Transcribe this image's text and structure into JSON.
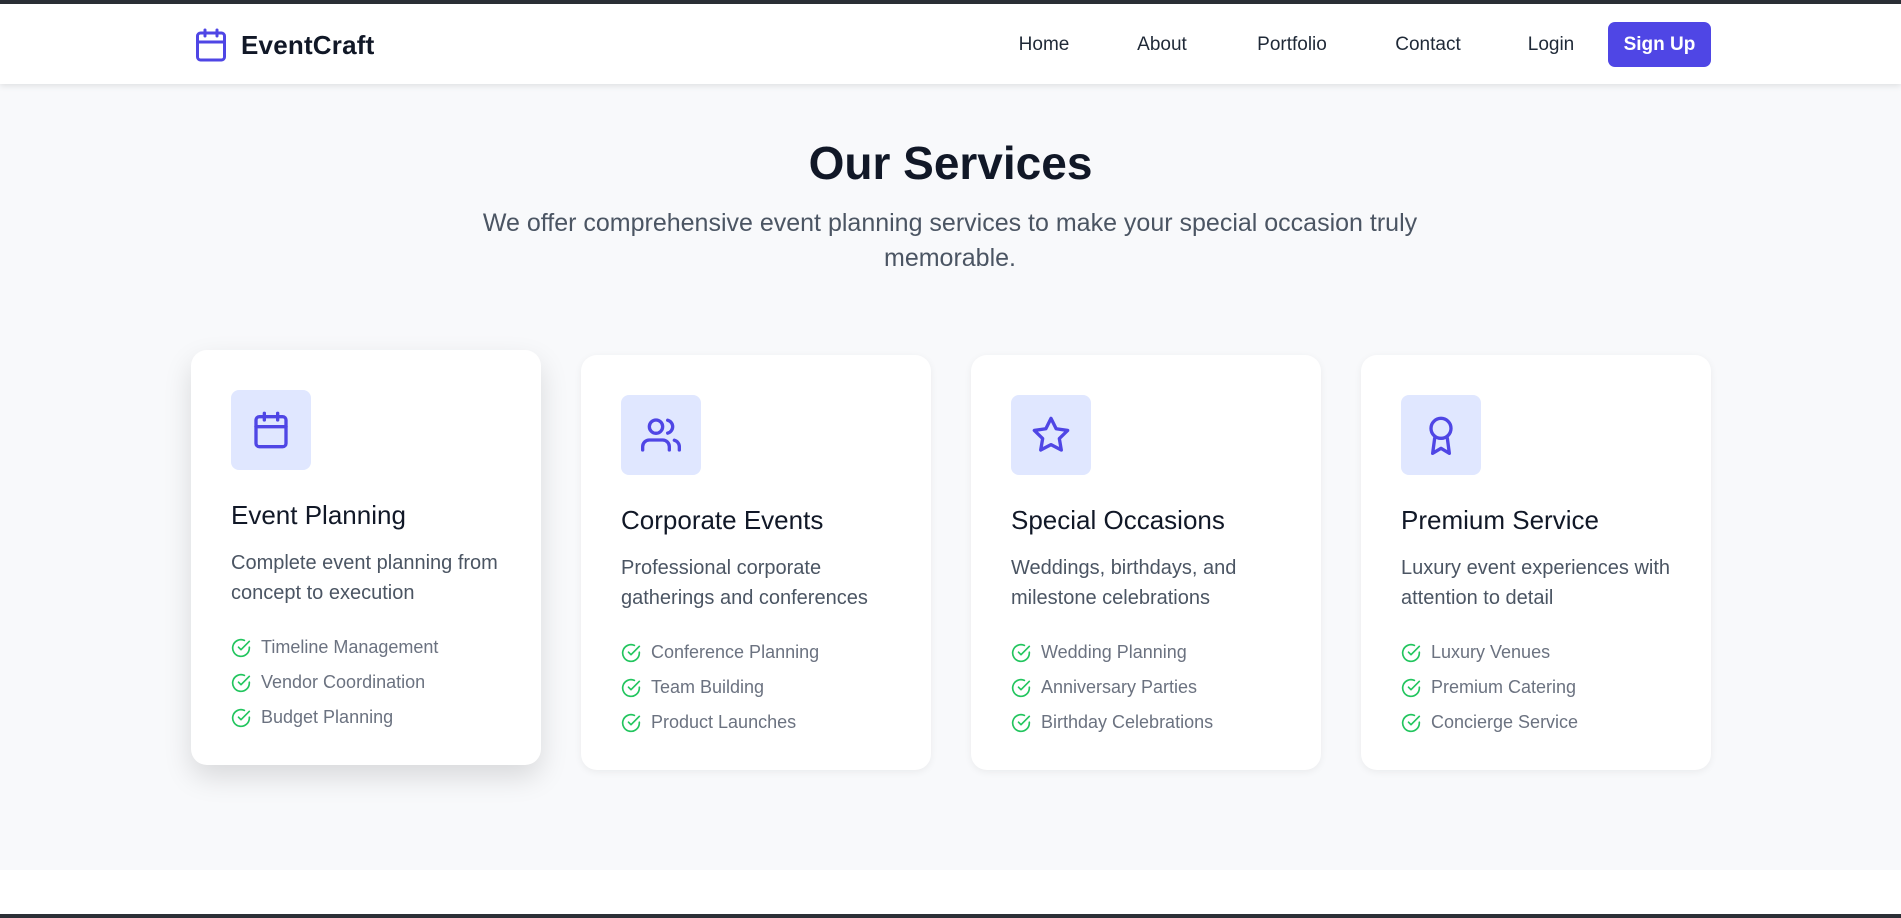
{
  "brand": {
    "name": "EventCraft",
    "icon": "calendar-icon"
  },
  "nav": {
    "links": [
      {
        "label": "Home",
        "name": "nav-link-home"
      },
      {
        "label": "About",
        "name": "nav-link-about"
      },
      {
        "label": "Portfolio",
        "name": "nav-link-portfolio"
      },
      {
        "label": "Contact",
        "name": "nav-link-contact"
      },
      {
        "label": "Login",
        "name": "nav-link-login"
      }
    ],
    "signup_label": "Sign Up"
  },
  "services": {
    "title": "Our Services",
    "subtitle": "We offer comprehensive event planning services to make your special occasion truly memorable.",
    "cards": [
      {
        "icon": "calendar-icon",
        "title": "Event Planning",
        "description": "Complete event planning from concept to execution",
        "features": [
          "Timeline Management",
          "Vendor Coordination",
          "Budget Planning"
        ]
      },
      {
        "icon": "users-icon",
        "title": "Corporate Events",
        "description": "Professional corporate gatherings and conferences",
        "features": [
          "Conference Planning",
          "Team Building",
          "Product Launches"
        ]
      },
      {
        "icon": "star-icon",
        "title": "Special Occasions",
        "description": "Weddings, birthdays, and milestone celebrations",
        "features": [
          "Wedding Planning",
          "Anniversary Parties",
          "Birthday Celebrations"
        ]
      },
      {
        "icon": "award-icon",
        "title": "Premium Service",
        "description": "Luxury event experiences with attention to detail",
        "features": [
          "Luxury Venues",
          "Premium Catering",
          "Concierge Service"
        ]
      }
    ]
  },
  "colors": {
    "accent": "#4f46e5",
    "icon_bg": "#e0e7ff",
    "check": "#22c55e",
    "heading": "#111827",
    "body_text": "#4b5563",
    "muted_text": "#6b7280",
    "section_bg": "#f8f9fb"
  },
  "feature_icon": "check-circle-icon"
}
